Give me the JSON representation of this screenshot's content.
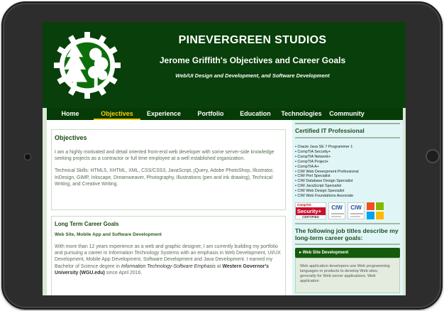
{
  "header": {
    "brand": "PINEVERGREEN STUDIOS",
    "subtitle": "Jerome Griffith's Objectives and Career Goals",
    "tagline": "Web/UI Design and Development, and Software Development"
  },
  "nav": {
    "items": [
      "Home",
      "Objectives",
      "Experience",
      "Portfolio",
      "Education",
      "Technologies",
      "Community"
    ],
    "active": "Objectives"
  },
  "objectives": {
    "title": "Objectives",
    "p1": "I am a highly motivated and detail oriented front-end web developer with some server-side knowledge seeking projects as a contractor or full time employee at a well established organization.",
    "p2": "Technical Skills: HTML5, XHTML, XML, CSS/CSS3, JavaScript, jQuery, Adobe PhotoShop, Illustrator, InDesign, GIMP, Inkscape, Dreamweaver, Photography, Illustrations (pen and ink drawing), Technical Writing, and Creative Writing."
  },
  "goals": {
    "title": "Long Term Career Goals",
    "subheading": "Web Site, Mobile App and Software Development",
    "p_start": "With more than 12 years experience as a web and graphic designer, I am currently building my portfolio and pursuing a career in Information Technology Systems with an emphasis in Web Development, UI/UX Development, Mobile App Development, Software Development and Java Development. I earned my Bachelor of Science degree in ",
    "p_degree": "Information Technology-Software Emphasis",
    "p_at": " at ",
    "p_school": "Western Governor's University (WGU.edu)",
    "p_end": " since April 2016."
  },
  "sidebar": {
    "cert_title": "Certified IT Professional",
    "certs": [
      "• Oracle Java SE 7 Programmer 1",
      "• CompTIA  Security+",
      "• CompTIA Network+",
      "• CompTIA Project+",
      "• CompTIA A+",
      "• CIW Web Deveopment Professional",
      "• CIW Perl Specialist",
      "• CIW Database Design Specialist",
      "• CIW JavaScript Specialist",
      "• CIW Web Design Specialist",
      "• CIW Web Foundations Associate"
    ],
    "badges": {
      "comptia_top": "CompTIA",
      "security": "Security+",
      "certified": "CERTIFIED",
      "ciw1": "CIW",
      "ciw2": "CIW"
    },
    "job_heading": "The following job titles describe my long-term career goals:",
    "accordion_label": "Web Site Development",
    "accordion_body": "Web application developers use Web programming languages or products to develop Web sites, generally for Web server applications. Web application"
  },
  "colors": {
    "header_bg": "#083f0a",
    "nav_active": "#ffcc00",
    "sidebar_bg": "#e0f6f6",
    "accent_green": "#155b0c"
  }
}
